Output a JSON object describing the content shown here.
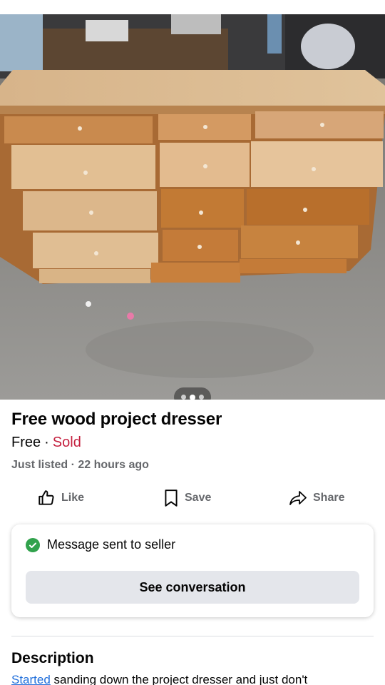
{
  "listing": {
    "title": "Free wood project dresser",
    "price": "Free",
    "separator": "·",
    "status": "Sold",
    "listed_time": "Just listed · 22 hours ago"
  },
  "gallery": {
    "photo_count": 3,
    "active_index": 1
  },
  "actions": {
    "like_label": "Like",
    "save_label": "Save",
    "share_label": "Share"
  },
  "message": {
    "status_text": "Message sent to seller",
    "button_label": "See conversation"
  },
  "description": {
    "heading": "Description",
    "text_link": "Started",
    "text_rest": " sanding down the project dresser and just don't"
  },
  "colors": {
    "sold": "#c41f3e",
    "check": "#31a24c",
    "secondary_text": "#65676b",
    "button_bg": "#e4e6eb"
  },
  "icons": {
    "like": "thumbs-up-icon",
    "save": "bookmark-icon",
    "share": "share-arrow-icon",
    "check": "check-circle-icon"
  }
}
